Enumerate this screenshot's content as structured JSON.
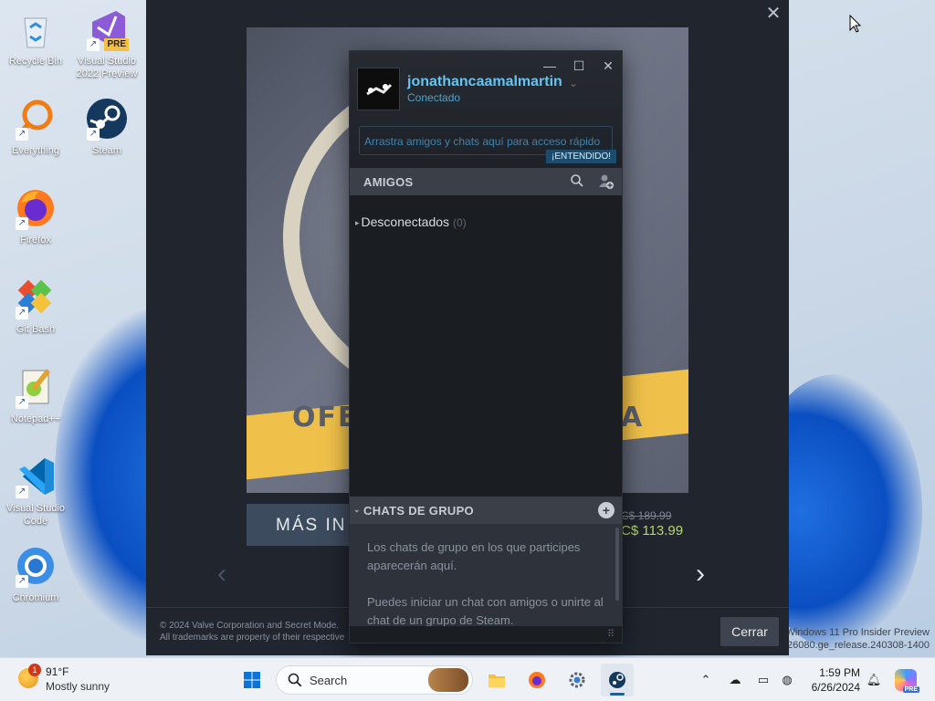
{
  "desktop": {
    "icons": [
      {
        "label": "Recycle Bin",
        "icon": "recycle-bin-icon"
      },
      {
        "label": "Visual Studio 2022 Preview",
        "icon": "visual-studio-preview-icon",
        "badge": "PRE"
      },
      {
        "label": "Everything",
        "icon": "everything-search-icon"
      },
      {
        "label": "Steam",
        "icon": "steam-icon"
      },
      {
        "label": "Firefox",
        "icon": "firefox-icon"
      },
      {
        "label": "Git Bash",
        "icon": "git-bash-icon"
      },
      {
        "label": "Notepad++",
        "icon": "notepad-plus-plus-icon"
      },
      {
        "label": "Visual Studio Code",
        "icon": "vscode-icon"
      },
      {
        "label": "Chromium",
        "icon": "chromium-icon"
      }
    ],
    "watermark_line1": "Windows 11 Pro Insider Preview",
    "watermark_line2": "26080.ge_release.240308-1400"
  },
  "store_dialog": {
    "banner_left_text": "OFE",
    "banner_right_text": "A",
    "more_button": "MÁS IN",
    "price_old": "C$ 189.99",
    "price_new": "C$ 113.99",
    "copyright_line1": "© 2024 Valve Corporation and Secret Mode.",
    "copyright_line2": "All trademarks are property of their respective",
    "close_button": "Cerrar"
  },
  "friends_window": {
    "username": "jonathancaamalmartin",
    "status": "Conectado",
    "drop_hint": "Arrastra amigos y chats aquí para acceso rápido",
    "got_it": "¡ENTENDIDO!",
    "friends_header": "AMIGOS",
    "offline_label": "Desconectados",
    "offline_count": "(0)",
    "groups_header": "CHATS DE GRUPO",
    "groups_text1": "Los chats de grupo en los que participes aparecerán aquí.",
    "groups_text2": "Puedes iniciar un chat con amigos o unirte al chat de un grupo de Steam."
  },
  "taskbar": {
    "weather_temp": "91°F",
    "weather_cond": "Mostly sunny",
    "weather_badge": "1",
    "search_label": "Search",
    "time": "1:59 PM",
    "date": "6/26/2024",
    "copilot_badge": "PRE"
  },
  "colors": {
    "accent": "#0067c0",
    "steam_link": "#62c5f4",
    "price_green": "#b6d86a"
  }
}
